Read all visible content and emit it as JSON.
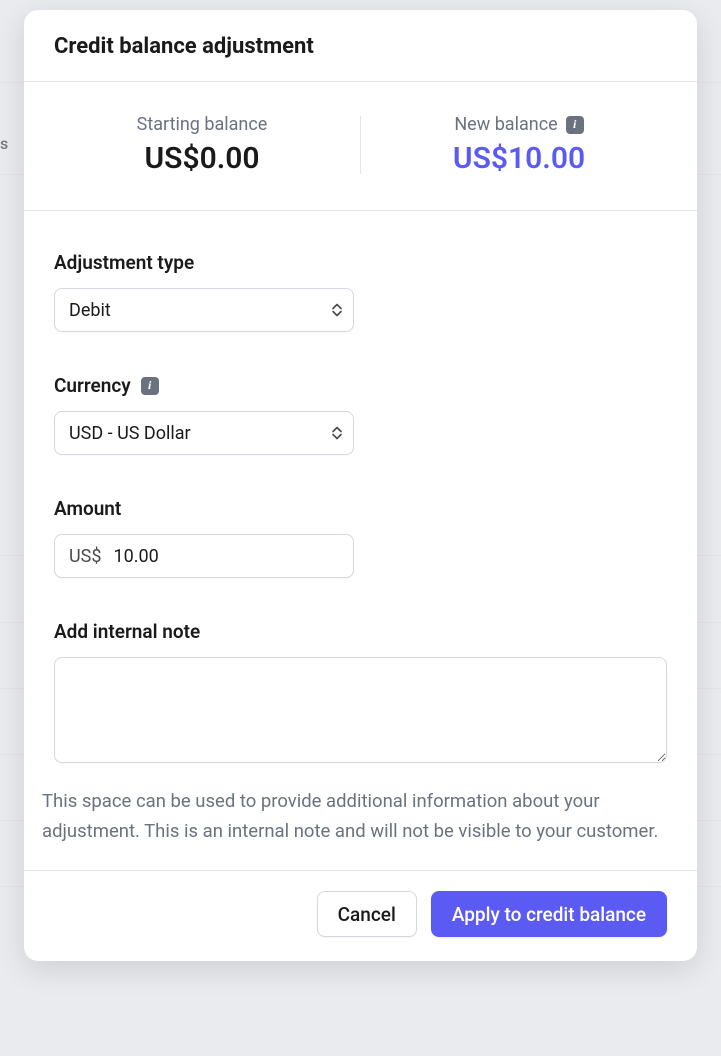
{
  "modal": {
    "title": "Credit balance adjustment",
    "starting_balance": {
      "label": "Starting balance",
      "value": "US$0.00"
    },
    "new_balance": {
      "label": "New balance",
      "value": "US$10.00"
    },
    "adjustment_type": {
      "label": "Adjustment type",
      "value": "Debit"
    },
    "currency": {
      "label": "Currency",
      "value": "USD - US Dollar"
    },
    "amount": {
      "label": "Amount",
      "prefix": "US$",
      "value": "10.00"
    },
    "note": {
      "label": "Add internal note",
      "value": "",
      "help": "This space can be used to provide additional information about your adjustment. This is an internal note and will not be visible to your customer."
    },
    "buttons": {
      "cancel": "Cancel",
      "apply": "Apply to credit balance"
    }
  },
  "background": {
    "partial_text": "s"
  }
}
